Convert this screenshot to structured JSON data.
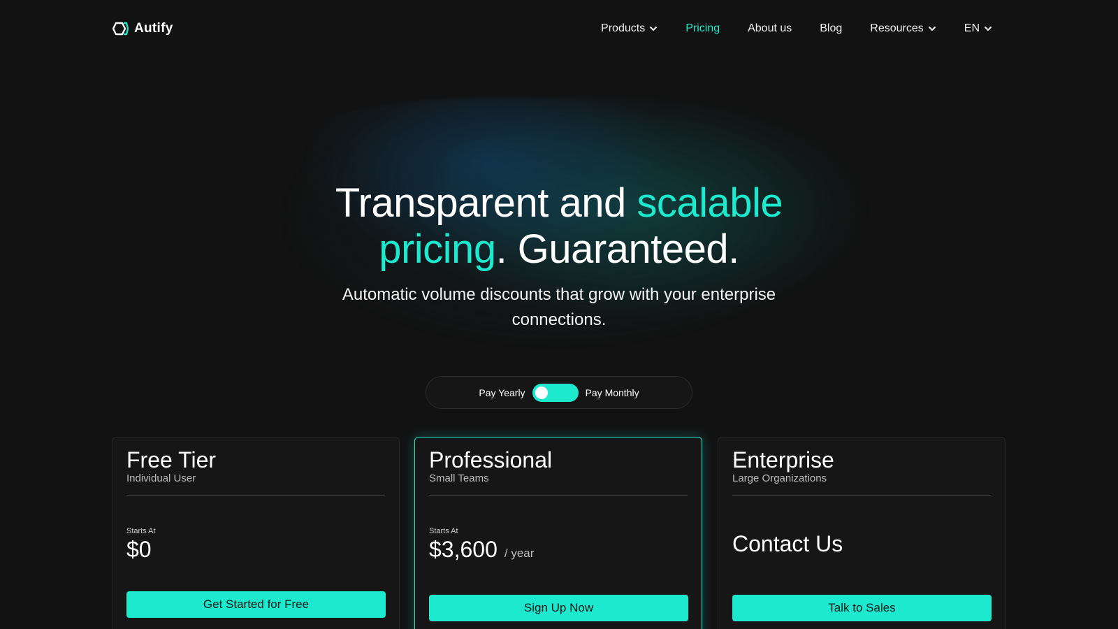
{
  "header": {
    "logo_text": "Autify",
    "nav": [
      {
        "label": "Products",
        "has_dropdown": true,
        "active": false
      },
      {
        "label": "Pricing",
        "has_dropdown": false,
        "active": true
      },
      {
        "label": "About us",
        "has_dropdown": false,
        "active": false
      },
      {
        "label": "Blog",
        "has_dropdown": false,
        "active": false
      },
      {
        "label": "Resources",
        "has_dropdown": true,
        "active": false
      },
      {
        "label": "EN",
        "has_dropdown": true,
        "active": false
      }
    ]
  },
  "hero": {
    "title_part1": "Transparent and ",
    "title_accent1": "scalable",
    "title_accent2": "pricing",
    "title_part2": ". Guaranteed.",
    "subtitle": "Automatic volume discounts that grow with your enterprise connections."
  },
  "billing": {
    "yearly_label": "Pay Yearly",
    "monthly_label": "Pay Monthly"
  },
  "plans": [
    {
      "name": "Free Tier",
      "audience": "Individual User",
      "starts_at": "Starts At",
      "price": "$0",
      "cta": "Get Started for Free"
    },
    {
      "name": "Professional",
      "audience": "Small Teams",
      "starts_at": "Starts At",
      "price": "$3,600",
      "period": "/ year",
      "cta": "Sign Up Now"
    },
    {
      "name": "Enterprise",
      "audience": "Large Organizations",
      "contact": "Contact Us",
      "cta": "Talk to Sales"
    }
  ],
  "colors": {
    "background": "#121212",
    "accent": "#1de9cf",
    "text": "#ffffff",
    "muted_text": "#bdbdbd",
    "card_border": "#262626"
  },
  "icons": {
    "logo": "hexagon-logo-icon",
    "dropdown": "chevron-down-icon"
  }
}
